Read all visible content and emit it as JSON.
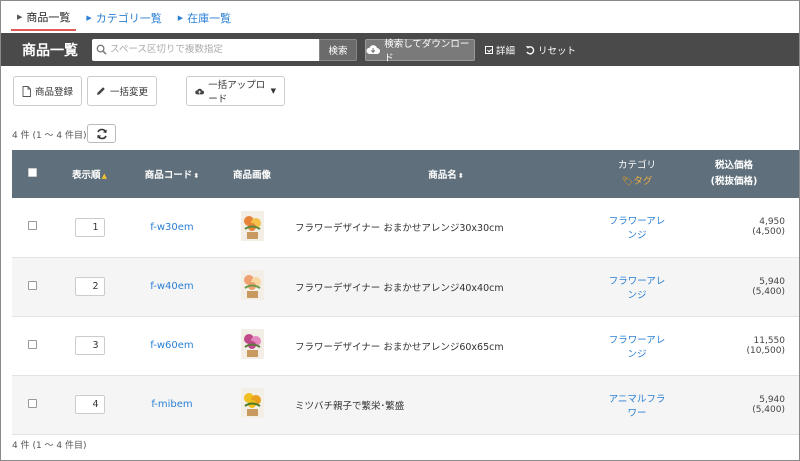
{
  "tabs": [
    {
      "label": "商品一覧",
      "active": true
    },
    {
      "label": "カテゴリ一覧",
      "active": false
    },
    {
      "label": "在庫一覧",
      "active": false
    }
  ],
  "topbar": {
    "title": "商品一覧",
    "search_placeholder": "スペース区切りで複数指定",
    "search_button": "検索",
    "download_button": "検索してダウンロード",
    "detail_link": "詳細",
    "reset_link": "リセット"
  },
  "toolbar": {
    "register": "商品登録",
    "bulk_edit": "一括変更",
    "bulk_upload": "一括アップロード"
  },
  "count_text": "4 件 (1 ～ 4 件目)",
  "columns": {
    "order": "表示順",
    "code": "商品コード",
    "image": "商品画像",
    "name": "商品名",
    "category": "カテゴリ",
    "tag": "タグ",
    "price": "税込価格",
    "price_sub": "(税抜価格)"
  },
  "rows": [
    {
      "order": "1",
      "code": "f-w30em",
      "name": "フラワーデザイナー おまかせアレンジ30x30cm",
      "category": "フラワーアレンジ",
      "price": "4,950",
      "price_ex": "(4,500)",
      "thumb": "orange"
    },
    {
      "order": "2",
      "code": "f-w40em",
      "name": "フラワーデザイナー おまかせアレンジ40x40cm",
      "category": "フラワーアレンジ",
      "price": "5,940",
      "price_ex": "(5,400)",
      "thumb": "peach"
    },
    {
      "order": "3",
      "code": "f-w60em",
      "name": "フラワーデザイナー おまかせアレンジ60x65cm",
      "category": "フラワーアレンジ",
      "price": "11,550",
      "price_ex": "(10,500)",
      "thumb": "pink"
    },
    {
      "order": "4",
      "code": "f-mibem",
      "name": "ミツバチ親子で繁栄･繁盛",
      "category": "アニマルフラワー",
      "price": "5,940",
      "price_ex": "(5,400)",
      "thumb": "yellow"
    }
  ],
  "colors": {
    "header_bg": "#5f6f7b",
    "topbar_bg": "#4a4a4a",
    "link": "#2a7fd4",
    "active_tab_underline": "#e05a5a"
  }
}
